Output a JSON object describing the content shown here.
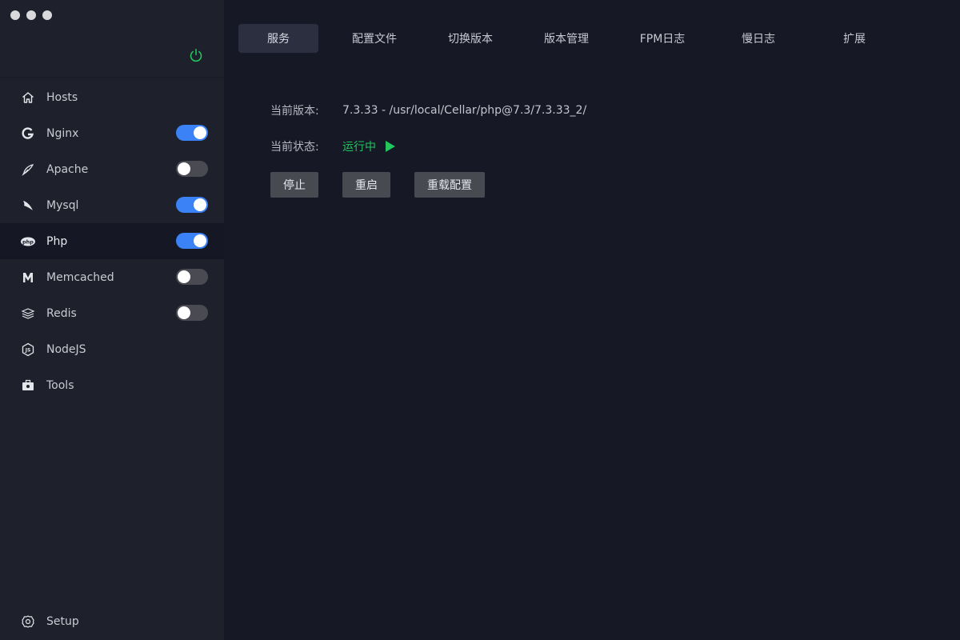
{
  "sidebar": {
    "items": [
      {
        "label": "Hosts",
        "icon": "home-icon",
        "toggle": null
      },
      {
        "label": "Nginx",
        "icon": "nginx-icon",
        "toggle": true
      },
      {
        "label": "Apache",
        "icon": "feather-icon",
        "toggle": false
      },
      {
        "label": "Mysql",
        "icon": "dolphin-icon",
        "toggle": true
      },
      {
        "label": "Php",
        "icon": "php-icon",
        "toggle": true
      },
      {
        "label": "Memcached",
        "icon": "memcached-icon",
        "toggle": false
      },
      {
        "label": "Redis",
        "icon": "redis-icon",
        "toggle": false
      },
      {
        "label": "NodeJS",
        "icon": "nodejs-icon",
        "toggle": null
      },
      {
        "label": "Tools",
        "icon": "toolbox-icon",
        "toggle": null
      }
    ],
    "active_index": 4,
    "setup_label": "Setup"
  },
  "tabs": [
    {
      "label": "服务",
      "active": true
    },
    {
      "label": "配置文件",
      "active": false
    },
    {
      "label": "切换版本",
      "active": false
    },
    {
      "label": "版本管理",
      "active": false
    },
    {
      "label": "FPM日志",
      "active": false
    },
    {
      "label": "慢日志",
      "active": false
    },
    {
      "label": "扩展",
      "active": false
    }
  ],
  "info": {
    "version_label": "当前版本:",
    "version_value": "7.3.33 - /usr/local/Cellar/php@7.3/7.3.33_2/",
    "status_label": "当前状态:",
    "status_value": "运行中"
  },
  "actions": {
    "stop": "停止",
    "restart": "重启",
    "reload": "重载配置"
  },
  "colors": {
    "accent": "#3b82f6",
    "running": "#22c55e",
    "power": "#22c55e"
  }
}
